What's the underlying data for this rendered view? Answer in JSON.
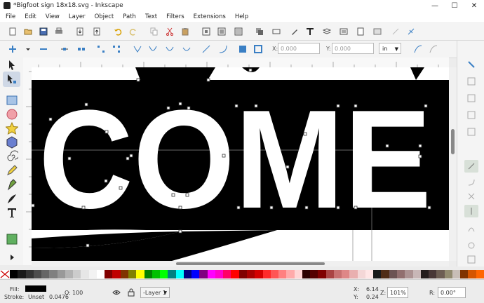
{
  "window": {
    "title": "*Bigfoot sign 18x18.svg - Inkscape"
  },
  "menu": [
    "File",
    "Edit",
    "View",
    "Layer",
    "Object",
    "Path",
    "Text",
    "Filters",
    "Extensions",
    "Help"
  ],
  "tool_controls": {
    "x_label": "X:",
    "x_value": "0.000",
    "y_label": "Y:",
    "y_value": "0.000",
    "unit": "in"
  },
  "canvas": {
    "word": "COME"
  },
  "status": {
    "fill_label": "Fill:",
    "stroke_label": "Stroke:",
    "stroke_value": "Unset",
    "stroke_width": "0.0476",
    "opacity_label": "O:",
    "opacity_value": "100",
    "layer": "-Layer 1",
    "x_label": "X:",
    "x_value": "6.14",
    "y_label": "Y:",
    "y_value": "0.24",
    "zoom_label": "Z:",
    "zoom_value": "101%",
    "rotate_label": "R:",
    "rotate_value": "0.00°"
  },
  "palette_colors": [
    "#000000",
    "#1a1a1a",
    "#333333",
    "#4d4d4d",
    "#666666",
    "#808080",
    "#999999",
    "#b3b3b3",
    "#cccccc",
    "#e6e6e6",
    "#f2f2f2",
    "#ffffff",
    "#800000",
    "#c00000",
    "#803300",
    "#808000",
    "#ffff00",
    "#008000",
    "#00c000",
    "#00ff00",
    "#008080",
    "#00ffff",
    "#000080",
    "#0000ff",
    "#800080",
    "#ff00ff",
    "#ff00cc",
    "#ff0066",
    "#ff0000",
    "#800000",
    "#aa0000",
    "#d40000",
    "#ff2a2a",
    "#ff5555",
    "#ff8080",
    "#ffaaaa",
    "#ffd5d5",
    "#2b0000",
    "#550000",
    "#800000",
    "#aa4444",
    "#c87171",
    "#de8787",
    "#e9afaf",
    "#f4d7d7",
    "#ffe6e6",
    "#1a1a1a",
    "#502d16",
    "#6c5353",
    "#916f6f",
    "#ac9393",
    "#c8b7b7",
    "#241c1c",
    "#483737",
    "#6c5d53",
    "#918a6f",
    "#c8beb7",
    "#803300",
    "#d45500",
    "#ff6600"
  ]
}
